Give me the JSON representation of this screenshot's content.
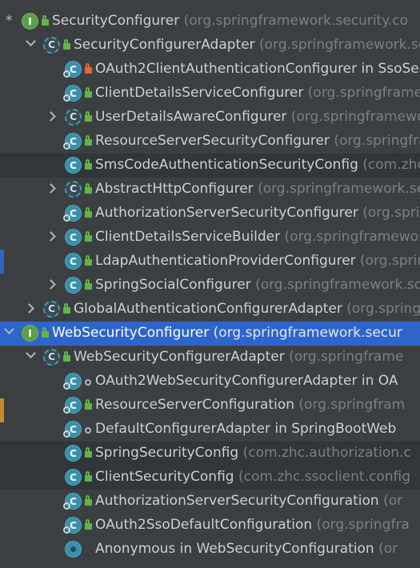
{
  "tree": {
    "rows": [
      {
        "name": "SecurityConfigurer",
        "pkg": "(org.springframework.security.co",
        "level": 0,
        "icon": "I",
        "vis": "pub",
        "expanded": true,
        "marker": "*",
        "state": ""
      },
      {
        "name": "SecurityConfigurerAdapter",
        "pkg": "(org.springframework.security.c",
        "level": 1,
        "icon": "A",
        "vis": "pub",
        "expanded": true,
        "state": ""
      },
      {
        "name": "OAuth2ClientAuthenticationConfigurer in SsoSec",
        "pkg": "",
        "level": 2,
        "icon": "C",
        "vis": "priv",
        "overlay": true,
        "state": ""
      },
      {
        "name": "ClientDetailsServiceConfigurer",
        "pkg": "(org.springframew",
        "level": 2,
        "icon": "C",
        "vis": "pub",
        "overlay": true,
        "state": ""
      },
      {
        "name": "UserDetailsAwareConfigurer",
        "pkg": "(org.springframewo",
        "level": 2,
        "icon": "A",
        "vis": "pub",
        "collapsed": true,
        "state": ""
      },
      {
        "name": "ResourceServerSecurityConfigurer",
        "pkg": "(org.springfra",
        "level": 2,
        "icon": "C",
        "vis": "pub",
        "overlay": true,
        "state": ""
      },
      {
        "name": "SmsCodeAuthenticationSecurityConfig",
        "pkg": "(com.zhc",
        "level": 2,
        "icon": "C",
        "vis": "pub",
        "state": "hl"
      },
      {
        "name": "AbstractHttpConfigurer",
        "pkg": "(org.springframework.se",
        "level": 2,
        "icon": "A",
        "vis": "pub",
        "collapsed": true,
        "state": ""
      },
      {
        "name": "AuthorizationServerSecurityConfigurer",
        "pkg": "(org.sprin",
        "level": 2,
        "icon": "C",
        "vis": "pub",
        "overlay": true,
        "state": ""
      },
      {
        "name": "ClientDetailsServiceBuilder",
        "pkg": "(org.springframework",
        "level": 2,
        "icon": "C",
        "vis": "pub",
        "collapsed": true,
        "state": ""
      },
      {
        "name": "LdapAuthenticationProviderConfigurer",
        "pkg": "(org.sprin",
        "level": 2,
        "icon": "C",
        "vis": "pub",
        "state": ""
      },
      {
        "name": "SpringSocialConfigurer",
        "pkg": "(org.springframework.soc",
        "level": 2,
        "icon": "C",
        "vis": "pub",
        "collapsed": true,
        "state": ""
      },
      {
        "name": "GlobalAuthenticationConfigurerAdapter",
        "pkg": "(org.spring",
        "level": 1,
        "icon": "A",
        "vis": "pub",
        "collapsed": true,
        "state": ""
      },
      {
        "name": "WebSecurityConfigurer",
        "pkg": "(org.springframework.secur",
        "level": 0,
        "icon": "I",
        "vis": "pub",
        "expanded": true,
        "state": "sel"
      },
      {
        "name": "WebSecurityConfigurerAdapter",
        "pkg": "(org.springframe",
        "level": 1,
        "icon": "A",
        "vis": "pub",
        "expanded": true,
        "state": ""
      },
      {
        "name": "OAuth2WebSecurityConfigurerAdapter in OA",
        "pkg": "",
        "level": 2,
        "icon": "C",
        "vis": "pkg",
        "overlay": true,
        "state": ""
      },
      {
        "name": "ResourceServerConfiguration",
        "pkg": "(org.springfram",
        "level": 2,
        "icon": "C",
        "vis": "pub",
        "overlay": true,
        "state": ""
      },
      {
        "name": "DefaultConfigurerAdapter in SpringBootWeb",
        "pkg": "",
        "level": 2,
        "icon": "C",
        "vis": "pkg",
        "overlay": true,
        "state": ""
      },
      {
        "name": "SpringSecurityConfig",
        "pkg": "(com.zhc.authorization.c",
        "level": 2,
        "icon": "C",
        "vis": "pub",
        "state": "hl"
      },
      {
        "name": "ClientSecurityConfig",
        "pkg": "(com.zhc.ssoclient.config",
        "level": 2,
        "icon": "C",
        "vis": "pub",
        "state": "hl"
      },
      {
        "name": "AuthorizationServerSecurityConfiguration",
        "pkg": "(or",
        "level": 2,
        "icon": "C",
        "vis": "pub",
        "overlay": true,
        "state": ""
      },
      {
        "name": "OAuth2SsoDefaultConfiguration",
        "pkg": "(org.springfra",
        "level": 2,
        "icon": "C",
        "vis": "pub",
        "overlay": true,
        "state": ""
      },
      {
        "name": "Anonymous in WebSecurityConfiguration",
        "pkg": "(or",
        "level": 2,
        "icon": "O",
        "vis": "",
        "state": ""
      }
    ]
  },
  "left_strip_colors": {
    "orange": "#c98b2a",
    "blue": "#2f65ca"
  },
  "colors": {
    "background": "#3c3f41",
    "selected": "#2f65ca",
    "highlight": "#323539"
  }
}
